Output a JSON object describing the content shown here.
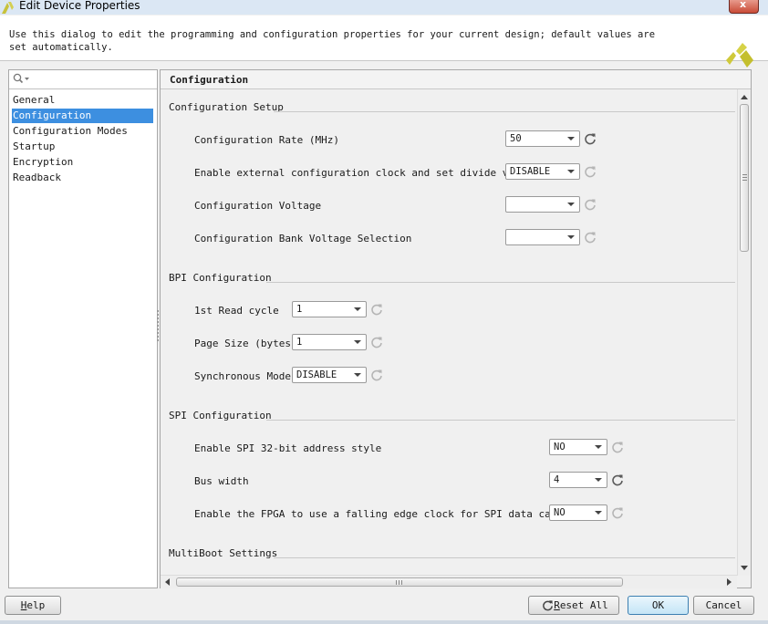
{
  "window": {
    "title": "Edit Device Properties",
    "close_label": "x"
  },
  "description": "Use this dialog to edit the programming and configuration properties for your current design; default values are set automatically.",
  "nav": {
    "search_placeholder": "",
    "items": [
      {
        "label": "General",
        "selected": false
      },
      {
        "label": "Configuration",
        "selected": true
      },
      {
        "label": "Configuration Modes",
        "selected": false
      },
      {
        "label": "Startup",
        "selected": false
      },
      {
        "label": "Encryption",
        "selected": false
      },
      {
        "label": "Readback",
        "selected": false
      }
    ]
  },
  "panel": {
    "title": "Configuration",
    "sections": [
      {
        "title": "Configuration Setup"
      },
      {
        "title": "BPI Configuration"
      },
      {
        "title": "SPI Configuration"
      },
      {
        "title": "MultiBoot Settings"
      }
    ],
    "rows": [
      {
        "label": "Configuration Rate (MHz)",
        "value": "50",
        "reset_active": true
      },
      {
        "label": "Enable external configuration clock and set divide value",
        "value": "DISABLE",
        "reset_active": false
      },
      {
        "label": "Configuration Voltage",
        "value": "",
        "reset_active": false
      },
      {
        "label": "Configuration Bank Voltage Selection",
        "value": "",
        "reset_active": false
      },
      {
        "label": "1st Read cycle",
        "value": "1",
        "reset_active": false
      },
      {
        "label": "Page Size (bytes)",
        "value": "1",
        "reset_active": false
      },
      {
        "label": "Synchronous Mode",
        "value": "DISABLE",
        "reset_active": false
      },
      {
        "label": "Enable SPI 32-bit address style",
        "value": "NO",
        "reset_active": false
      },
      {
        "label": "Bus width",
        "value": "4",
        "reset_active": true
      },
      {
        "label": "Enable the FPGA to use a falling edge clock for SPI data capture",
        "value": "NO",
        "reset_active": false
      }
    ]
  },
  "buttons": {
    "help": {
      "mnemonic": "H",
      "rest": "elp"
    },
    "reset_all": {
      "mnemonic": "R",
      "rest": "eset All"
    },
    "ok": "OK",
    "cancel": "Cancel"
  },
  "colors": {
    "selection": "#3d8fe0",
    "logo": "#c8c23c"
  },
  "icons": {
    "reset": "refresh-icon",
    "search": "search-icon"
  }
}
